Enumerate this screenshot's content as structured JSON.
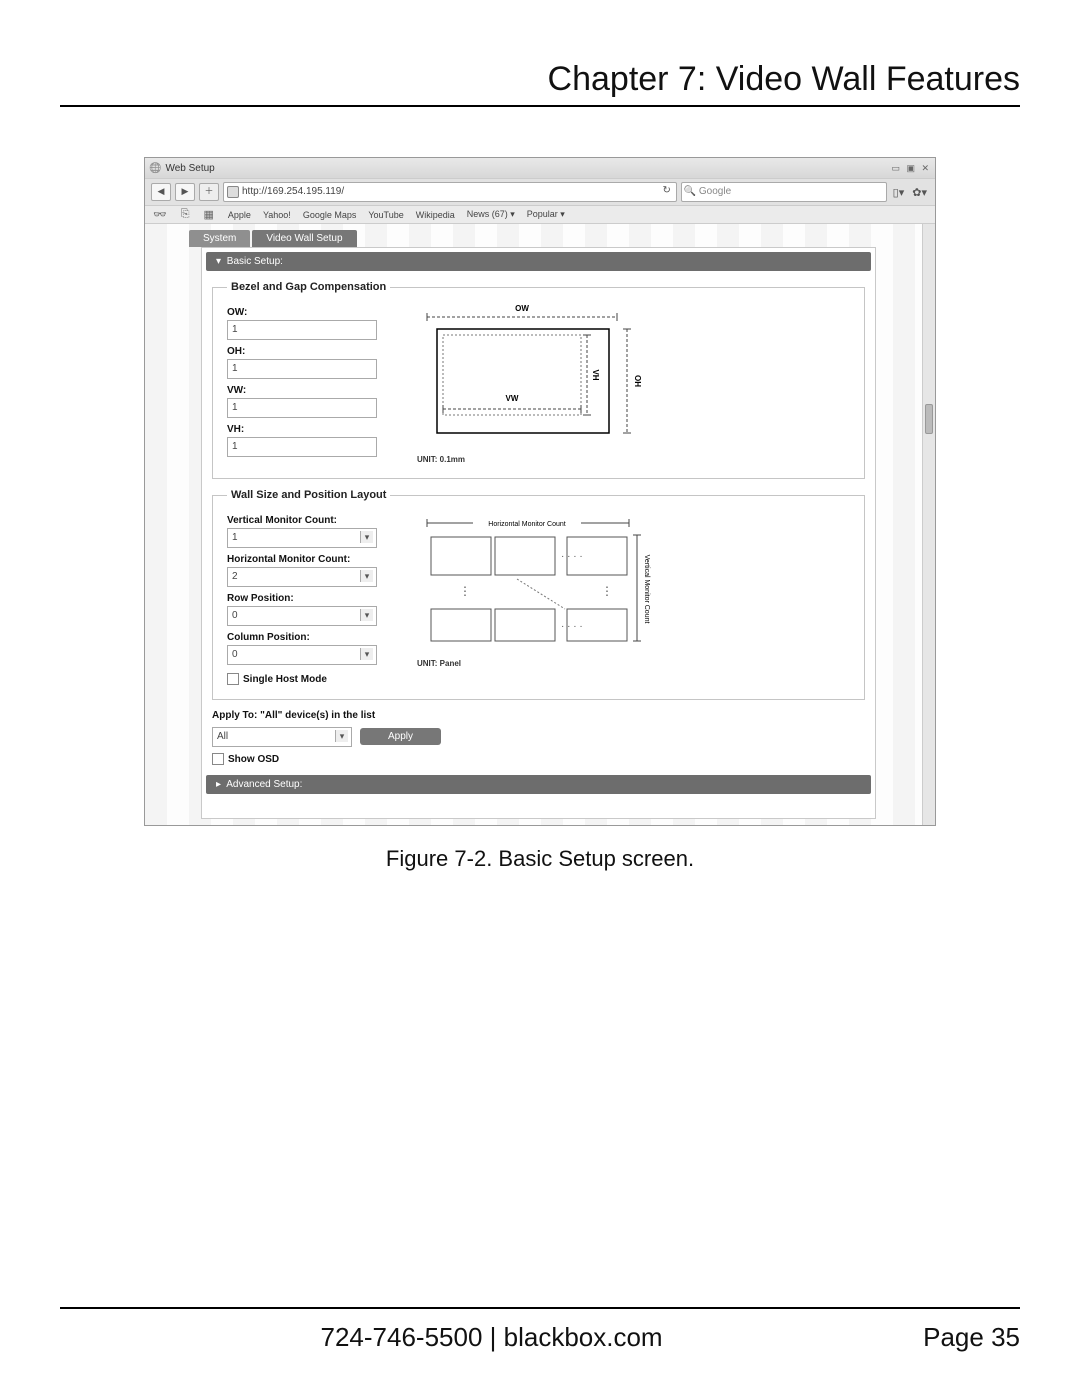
{
  "page": {
    "chapter_title": "Chapter 7: Video Wall Features",
    "figure_caption": "Figure 7-2. Basic Setup screen.",
    "footer_contact": "724-746-5500   |   blackbox.com",
    "footer_page": "Page 35"
  },
  "window": {
    "title": "Web Setup",
    "url": "http://169.254.195.119/",
    "search_placeholder": "Google",
    "bookmarks": [
      "Apple",
      "Yahoo!",
      "Google Maps",
      "YouTube",
      "Wikipedia",
      "News (67) ▾",
      "Popular ▾"
    ]
  },
  "tabs": {
    "system": "System",
    "video_wall": "Video Wall Setup"
  },
  "accordion": {
    "basic": "Basic Setup:",
    "advanced": "Advanced Setup:"
  },
  "bezel": {
    "legend": "Bezel and Gap Compensation",
    "ow_label": "OW:",
    "ow_value": "1",
    "oh_label": "OH:",
    "oh_value": "1",
    "vw_label": "VW:",
    "vw_value": "1",
    "vh_label": "VH:",
    "vh_value": "1",
    "unit_label": "UNIT: 0.1mm",
    "diag": {
      "ow": "OW",
      "oh": "OH",
      "vw": "VW",
      "vh": "VH"
    }
  },
  "layout": {
    "legend": "Wall Size and Position Layout",
    "vcount_label": "Vertical Monitor Count:",
    "vcount_value": "1",
    "hcount_label": "Horizontal Monitor Count:",
    "hcount_value": "2",
    "rowpos_label": "Row Position:",
    "rowpos_value": "0",
    "colpos_label": "Column Position:",
    "colpos_value": "0",
    "single_host": "Single Host Mode",
    "unit_label": "UNIT: Panel",
    "diag": {
      "h_label": "Horizontal Monitor Count",
      "v_label": "Vertical Monitor Count"
    }
  },
  "apply": {
    "heading": "Apply To: \"All\" device(s) in the list",
    "target_value": "All",
    "button": "Apply",
    "show_osd": "Show OSD"
  }
}
